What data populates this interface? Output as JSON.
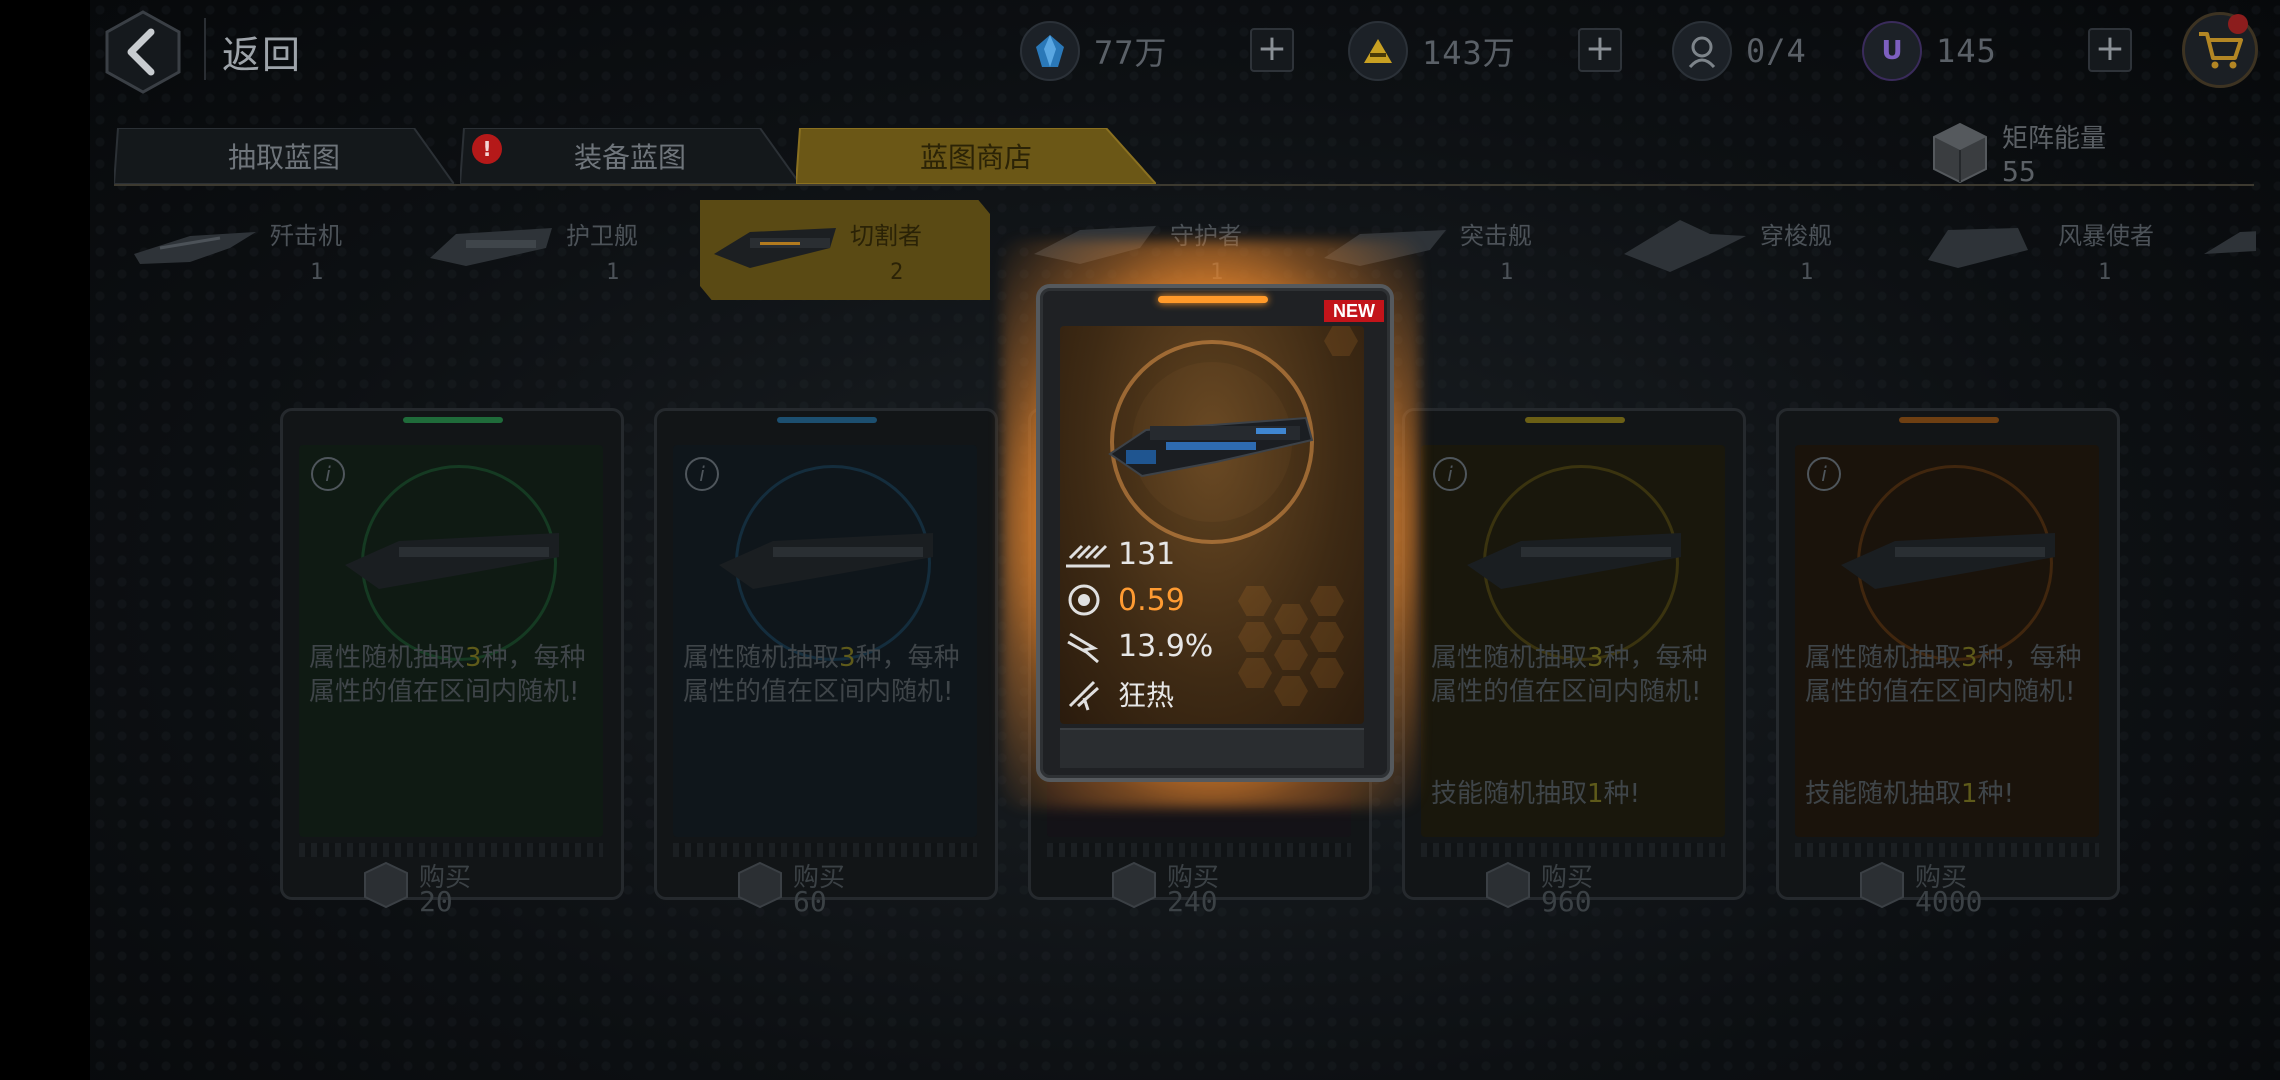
{
  "topbar": {
    "back_label": "返回",
    "crystals": "77万",
    "gold": "143万",
    "crew": "0/4",
    "ucoin": "145"
  },
  "tabs": [
    {
      "label": "抽取蓝图",
      "active": false
    },
    {
      "label": "装备蓝图",
      "active": false,
      "badge": "!"
    },
    {
      "label": "蓝图商店",
      "active": true
    }
  ],
  "matrix": {
    "label": "矩阵能量",
    "value": "55"
  },
  "ships": [
    {
      "name": "歼击机",
      "count": "1",
      "selected": false
    },
    {
      "name": "护卫舰",
      "count": "1",
      "selected": false
    },
    {
      "name": "切割者",
      "count": "2",
      "selected": true
    },
    {
      "name": "守护者",
      "count": "1",
      "selected": false
    },
    {
      "name": "突击舰",
      "count": "1",
      "selected": false
    },
    {
      "name": "穿梭舰",
      "count": "1",
      "selected": false
    },
    {
      "name": "风暴使者",
      "count": "1",
      "selected": false
    }
  ],
  "cards": [
    {
      "desc_pre": "属性随机抽取",
      "desc_num": "3",
      "desc_post": "种，每种属性的值在区间内随机!",
      "skill": "",
      "buy": "购买",
      "price": "20",
      "color": "#1f6b3a"
    },
    {
      "desc_pre": "属性随机抽取",
      "desc_num": "3",
      "desc_post": "种，每种属性的值在区间内随机!",
      "skill": "",
      "buy": "购买",
      "price": "60",
      "color": "#1c4f70"
    },
    {
      "buy": "购买",
      "price": "240"
    },
    {
      "desc_pre": "属性随机抽取",
      "desc_num": "3",
      "desc_post": "种，每种属性的值在区间内随机!",
      "skill_pre": "技能随机抽取",
      "skill_num": "1",
      "skill_post": "种!",
      "buy": "购买",
      "price": "960",
      "color": "#6b5f15"
    },
    {
      "desc_pre": "属性随机抽取",
      "desc_num": "3",
      "desc_post": "种，每种属性的值在区间内随机!",
      "skill_pre": "技能随机抽取",
      "skill_num": "1",
      "skill_post": "种!",
      "buy": "购买",
      "price": "4000",
      "color": "#6e3f12"
    }
  ],
  "featured": {
    "badge": "NEW",
    "stat_attack": "131",
    "stat_rate": "0.59",
    "stat_crit": "13.9%",
    "stat_skill": "狂热",
    "accent": "#ff9a2a"
  }
}
